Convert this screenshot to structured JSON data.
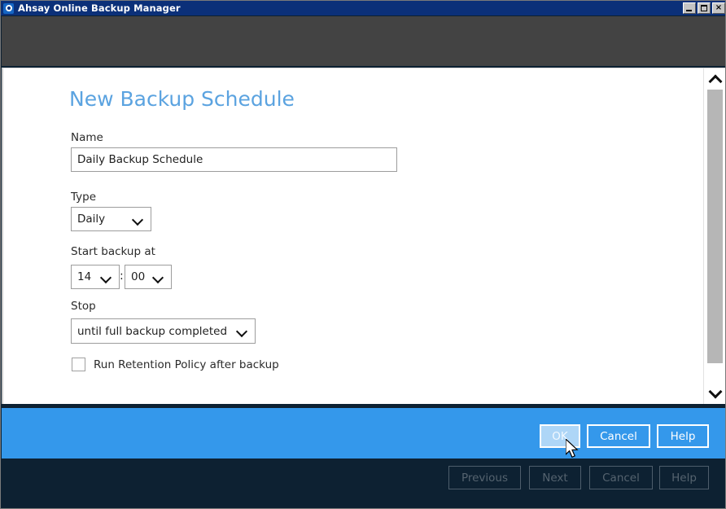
{
  "window": {
    "title": "Ahsay Online Backup Manager",
    "icon": "app-logo-icon",
    "controls": {
      "minimize": "_",
      "maximize": "□",
      "close": "×"
    }
  },
  "dialog": {
    "title": "New Backup Schedule",
    "fields": {
      "name": {
        "label": "Name",
        "value": "Daily Backup Schedule",
        "placeholder": ""
      },
      "type": {
        "label": "Type",
        "value": "Daily"
      },
      "start_backup_at": {
        "label": "Start backup at",
        "hour": "14",
        "minute": "00",
        "separator": ":"
      },
      "stop": {
        "label": "Stop",
        "value": "until full backup completed"
      },
      "retention": {
        "label": "Run Retention Policy after backup",
        "checked": false
      }
    }
  },
  "action_bar": {
    "ok_label": "OK",
    "cancel_label": "Cancel",
    "help_label": "Help"
  },
  "wizard_bar": {
    "previous_label": "Previous",
    "next_label": "Next",
    "cancel_label": "Cancel",
    "help_label": "Help"
  },
  "scrollbar": {
    "up_icon": "chevron-up-icon",
    "down_icon": "chevron-down-icon"
  },
  "colors": {
    "title_bar": "#0b3079",
    "header_strip": "#434343",
    "accent_blue": "#3498eb",
    "dark_navy": "#0d2132",
    "heading_blue": "#5ba3e0",
    "ok_hover": "#aed6f7"
  }
}
